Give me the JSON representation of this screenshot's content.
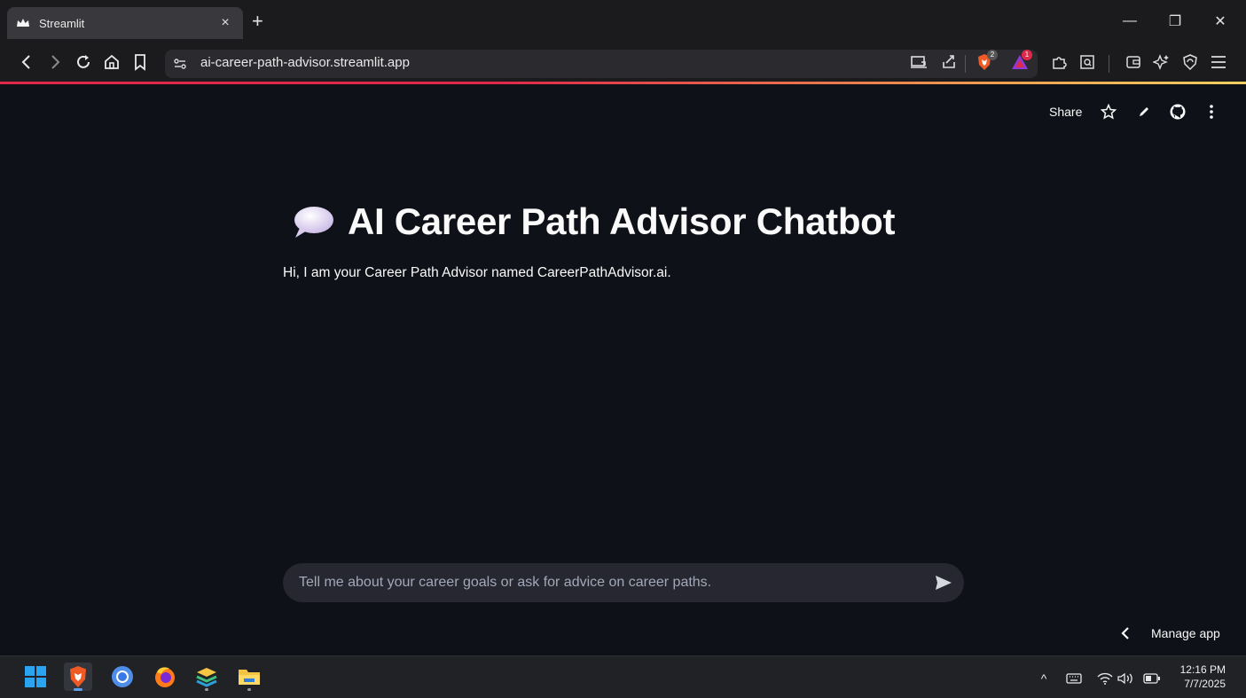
{
  "browser": {
    "tab_title": "Streamlit",
    "tab_close": "×",
    "new_tab": "+",
    "url": "ai-career-path-advisor.streamlit.app",
    "window_controls": {
      "minimize": "—",
      "restore": "❐",
      "close": "✕"
    },
    "shields_badge": "2",
    "rewards_badge": "1"
  },
  "app": {
    "header": {
      "share_label": "Share"
    },
    "title": "AI Career Path Advisor Chatbot",
    "intro_message": "Hi, I am your Career Path Advisor named CareerPathAdvisor.ai.",
    "chat_input": {
      "placeholder": "Tell me about your career goals or ask for advice on career paths."
    },
    "manage_app_label": "Manage app"
  },
  "taskbar": {
    "tray_caret": "^",
    "time": "12:16 PM",
    "date": "7/7/2025"
  },
  "colors": {
    "app_background": "#0e1117",
    "chat_input_background": "#262730",
    "browser_chrome": "#1b1b1d",
    "brave_accent": "#e0284a",
    "taskbar": "#202226"
  }
}
